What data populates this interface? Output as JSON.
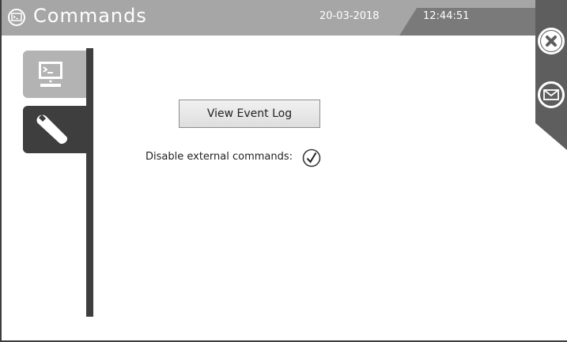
{
  "header": {
    "title": "Commands",
    "date": "20-03-2018",
    "time": "12:44:51"
  },
  "sidebar": {
    "tabs": [
      {
        "name": "terminal",
        "icon": "monitor-terminal-icon",
        "active": false
      },
      {
        "name": "tools",
        "icon": "wrench-icon",
        "active": true
      }
    ]
  },
  "main": {
    "event_log_button": "View Event Log",
    "disable_external_label": "Disable external commands:",
    "disable_external_checked": true
  },
  "actions": {
    "close_icon": "close-icon",
    "mail_icon": "mail-icon"
  },
  "colors": {
    "header_bg": "#a6a6a6",
    "clock_bg": "#7a7a7a",
    "active_tab": "#3e3e3e",
    "inactive_tab": "#b3b3b3",
    "rightbar": "#5e5e5e"
  }
}
